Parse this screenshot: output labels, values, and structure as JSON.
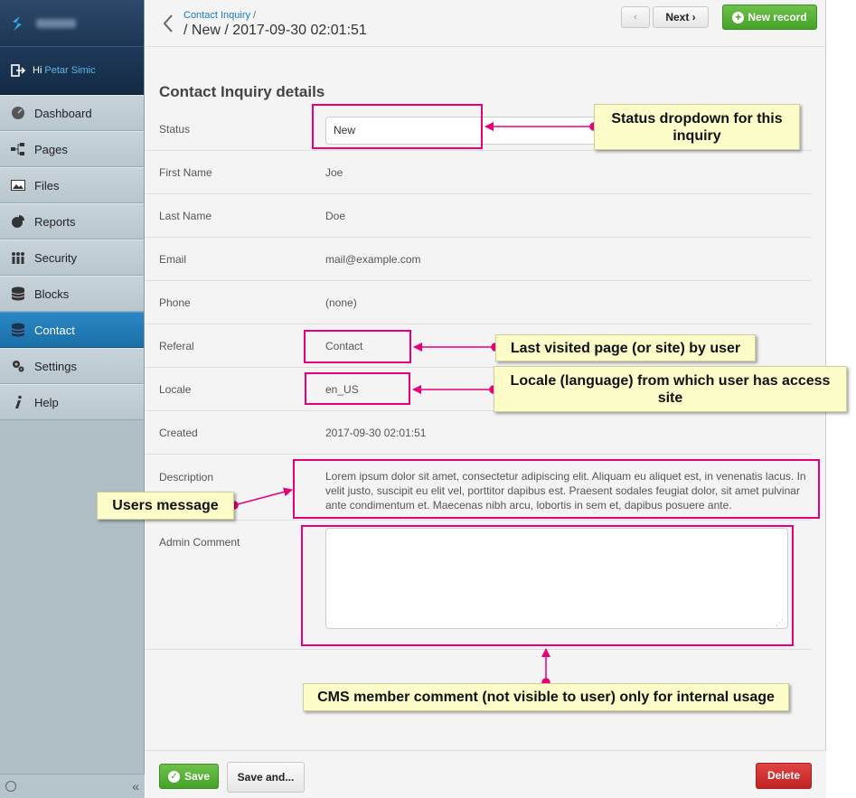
{
  "sidebar": {
    "greeting": "Hi",
    "user_name": "Petar Simic",
    "items": [
      {
        "label": "Dashboard",
        "icon": "dashboard-icon"
      },
      {
        "label": "Pages",
        "icon": "sitemap-icon"
      },
      {
        "label": "Files",
        "icon": "image-icon"
      },
      {
        "label": "Reports",
        "icon": "pie-chart-icon"
      },
      {
        "label": "Security",
        "icon": "users-icon"
      },
      {
        "label": "Blocks",
        "icon": "database-icon"
      },
      {
        "label": "Contact",
        "icon": "database-icon",
        "active": true
      },
      {
        "label": "Settings",
        "icon": "gears-icon"
      },
      {
        "label": "Help",
        "icon": "info-icon"
      }
    ],
    "collapse_symbol": "«"
  },
  "header": {
    "breadcrumb_link": "Contact Inquiry",
    "breadcrumb_separator": "/",
    "title": "/ New / 2017-09-30 02:01:51",
    "prev_label": "‹",
    "next_label": "Next ›",
    "new_record_label": "New record"
  },
  "form": {
    "section_title": "Contact Inquiry details",
    "status": {
      "label": "Status",
      "value": "New"
    },
    "first_name": {
      "label": "First Name",
      "value": "Joe"
    },
    "last_name": {
      "label": "Last Name",
      "value": "Doe"
    },
    "email": {
      "label": "Email",
      "value": "mail@example.com"
    },
    "phone": {
      "label": "Phone",
      "value": "(none)"
    },
    "referal": {
      "label": "Referal",
      "value": "Contact"
    },
    "locale": {
      "label": "Locale",
      "value": "en_US"
    },
    "created": {
      "label": "Created",
      "value": "2017-09-30 02:01:51"
    },
    "description": {
      "label": "Description",
      "value": "Lorem ipsum dolor sit amet, consectetur adipiscing elit. Aliquam eu aliquet est, in venenatis lacus. In velit justo, suscipit eu elit vel, porttitor dapibus est. Praesent sodales feugiat dolor, sit amet pulvinar ante condimentum et. Maecenas nibh arcu, lobortis in sem et, dapibus posuere ante."
    },
    "admin_comment": {
      "label": "Admin Comment",
      "value": ""
    }
  },
  "footer": {
    "save_label": "Save",
    "save_and_label": "Save and...",
    "delete_label": "Delete"
  },
  "annotations": {
    "status": "Status dropdown for this inquiry",
    "referal": "Last visited page (or site) by user",
    "locale": "Locale (language) from which user has access site",
    "description": "Users message",
    "admin_comment": "CMS member comment (not visible to user) only for internal usage"
  },
  "colors": {
    "accent": "#1a79c1",
    "annotation_border": "#e8007a",
    "annotation_bg": "#fdfdc9",
    "success": "#45a227",
    "danger": "#c22222"
  }
}
